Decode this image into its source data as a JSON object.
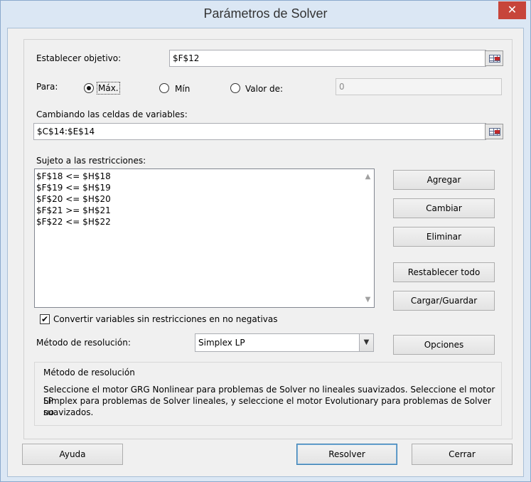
{
  "window": {
    "title": "Parámetros de Solver",
    "close_glyph": "✕"
  },
  "objective": {
    "label": "Establecer objetivo:",
    "value": "$F$12"
  },
  "to": {
    "label": "Para:",
    "max_label": "Máx.",
    "min_label": "Mín",
    "value_of_label": "Valor de:",
    "value_of_input": "0",
    "selected": "max"
  },
  "variables": {
    "label": "Cambiando las celdas de variables:",
    "value": "$C$14:$E$14"
  },
  "constraints": {
    "label": "Sujeto a las restricciones:",
    "items": [
      "$F$18 <= $H$18",
      "$F$19 <= $H$19",
      "$F$20 <= $H$20",
      "$F$21 >= $H$21",
      "$F$22 <= $H$22"
    ]
  },
  "side_buttons": {
    "add": "Agregar",
    "change": "Cambiar",
    "delete": "Eliminar",
    "reset": "Restablecer todo",
    "load_save": "Cargar/Guardar",
    "options": "Opciones"
  },
  "nonneg": {
    "label": "Convertir variables sin restricciones en no negativas",
    "checked": true,
    "check_glyph": "✔"
  },
  "method": {
    "label": "Método de resolución:",
    "selected": "Simplex LP",
    "dropdown_glyph": "▼"
  },
  "info": {
    "title": "Método de resolución",
    "line1": "Seleccione el motor GRG Nonlinear para problemas de Solver no lineales suavizados. Seleccione el motor LP",
    "line2": "Simplex para problemas de Solver lineales, y seleccione el motor Evolutionary para problemas de Solver no",
    "line3": "suavizados."
  },
  "footer": {
    "help": "Ayuda",
    "solve": "Resolver",
    "close": "Cerrar"
  },
  "icons": {
    "range_selector": "range-select-icon",
    "scroll_up": "▲",
    "scroll_down": "▼"
  },
  "colors": {
    "frame": "#dbe7f4",
    "client": "#f0f0f0",
    "close": "#c7453a",
    "default_button_border": "#3c7fb1"
  }
}
